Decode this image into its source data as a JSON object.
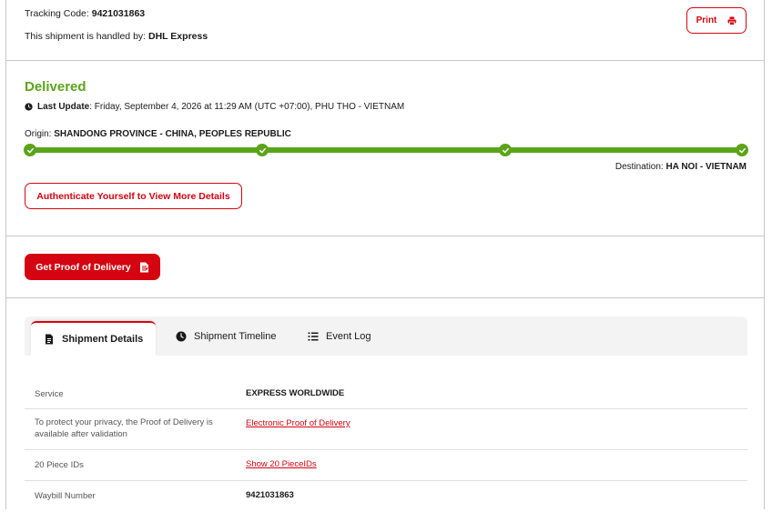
{
  "header": {
    "tracking_label": "Tracking Code:",
    "tracking_code": "9421031863",
    "handled_label": "This shipment is handled by:",
    "handled_by": "DHL Express",
    "print_label": "Print"
  },
  "status": {
    "title": "Delivered",
    "last_update_label": "Last Update",
    "last_update_value": ": Friday, September 4, 2026 at 11:29 AM (UTC +07:00), PHU THO - VIETNAM",
    "origin_label": "Origin:",
    "origin_value": "SHANDONG PROVINCE - CHINA, PEOPLES REPUBLIC",
    "destination_label": "Destination:",
    "destination_value": "HA NOI - VIETNAM",
    "auth_button": "Authenticate Yourself to View More Details"
  },
  "pod": {
    "button_label": "Get Proof of Delivery"
  },
  "tabs": [
    {
      "label": "Shipment Details",
      "icon": "document-icon",
      "active": true
    },
    {
      "label": "Shipment Timeline",
      "icon": "clock-icon",
      "active": false
    },
    {
      "label": "Event Log",
      "icon": "list-icon",
      "active": false
    }
  ],
  "details": [
    {
      "label": "Service",
      "value": "EXPRESS WORLDWIDE",
      "type": "strong"
    },
    {
      "label": "To protect your privacy, the Proof of Delivery is available after validation",
      "value": "Electronic Proof of Delivery",
      "type": "link"
    },
    {
      "label": "20 Piece IDs",
      "value": "Show 20 PieceIDs",
      "type": "link"
    },
    {
      "label": "Waybill Number",
      "value": "9421031863",
      "type": "strong"
    }
  ],
  "colors": {
    "accent": "#d40511",
    "success": "#5ba41a"
  }
}
